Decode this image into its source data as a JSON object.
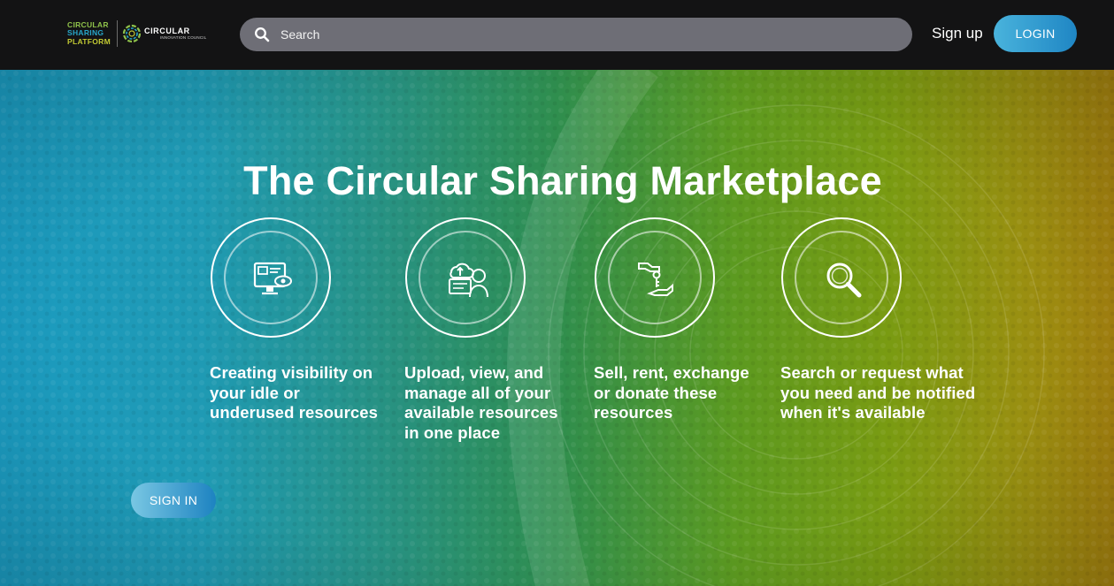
{
  "header": {
    "logo_primary": [
      "CIRCULAR",
      "SHARING",
      "PLATFORM"
    ],
    "logo_secondary": "CIRCULAR",
    "logo_secondary_sub": "INNOVATION COUNCIL",
    "search_placeholder": "Search",
    "signup_label": "Sign up",
    "login_label": "LOGIN"
  },
  "hero": {
    "title": "The Circular Sharing Marketplace",
    "features": [
      {
        "icon": "monitor-eye-icon",
        "text": "Creating visibility on your idle or underused resources"
      },
      {
        "icon": "user-upload-icon",
        "text": "Upload, view, and manage all of your available resources in one place"
      },
      {
        "icon": "hand-key-icon",
        "text": "Sell, rent, exchange or donate these resources"
      },
      {
        "icon": "magnifier-icon",
        "text": "Search or request what you need and be notified when it's available"
      }
    ],
    "signin_label": "SIGN IN"
  },
  "colors": {
    "topbar": "#131314",
    "search_bg": "#6e6e76",
    "button_gradient_start": "#49b3dc",
    "button_gradient_end": "#1f86c4",
    "hero_left": "#1b9bc0",
    "hero_mid": "#2f8e4e",
    "hero_right": "#a2800f"
  }
}
